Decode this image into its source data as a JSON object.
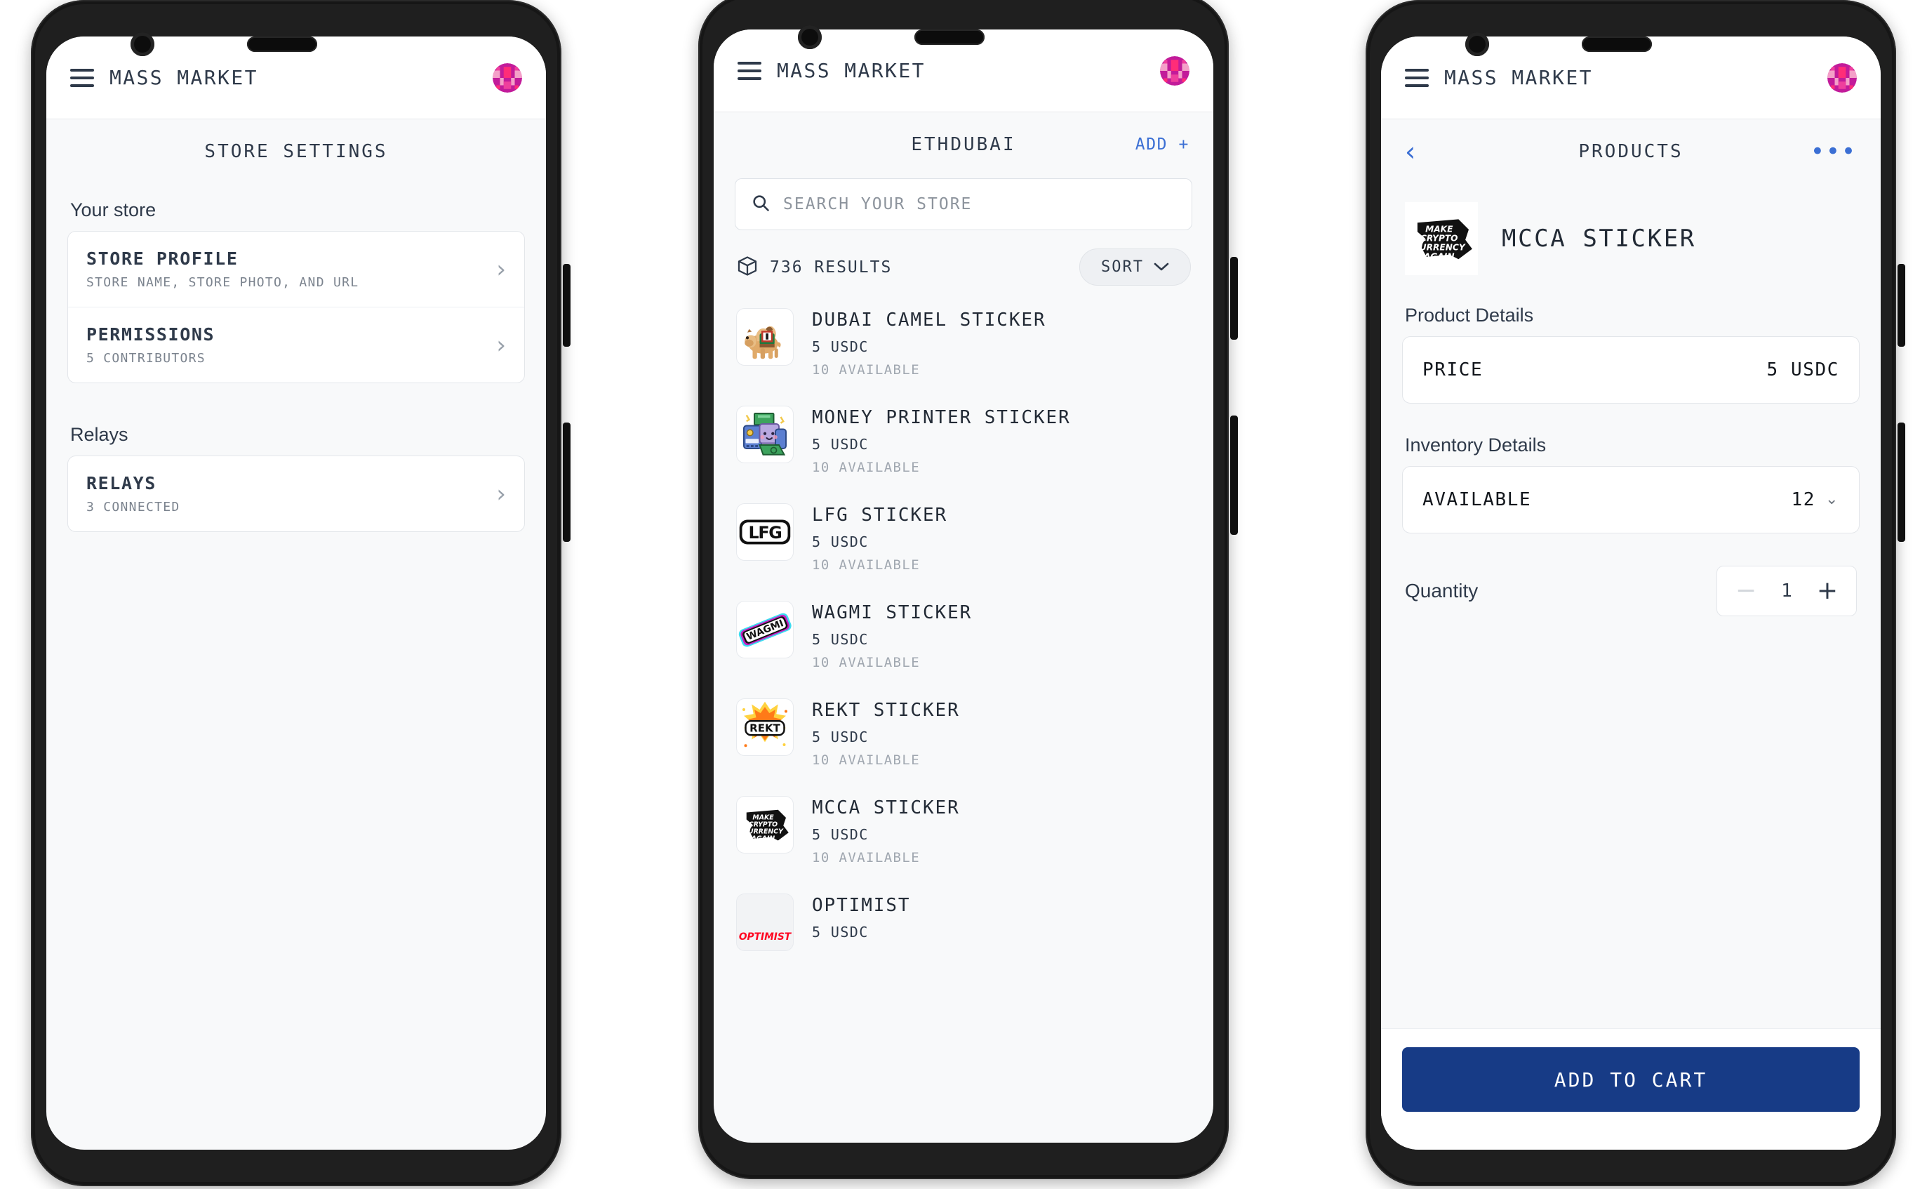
{
  "app": {
    "brand": "MASS MARKET",
    "menu_icon": "hamburger-icon",
    "avatar_icon": "blockie-avatar"
  },
  "colors": {
    "accent_blue": "#3b6fd4",
    "cta_blue": "#173b86",
    "avatar_magenta": "#c21b9a",
    "avatar_pink": "#ef3f9d",
    "text_dark": "#2f3a4a",
    "text_muted": "#a0a7b0",
    "screen_bg": "#f8f9fa"
  },
  "screen1": {
    "page_title": "STORE SETTINGS",
    "sections": [
      {
        "label": "Your store",
        "rows": [
          {
            "title": "STORE PROFILE",
            "subtitle": "STORE NAME, STORE PHOTO, AND URL",
            "chevron": "chevron-right-icon"
          },
          {
            "title": "PERMISSIONS",
            "subtitle": "5 CONTRIBUTORS",
            "chevron": "chevron-right-icon"
          }
        ]
      },
      {
        "label": "Relays",
        "rows": [
          {
            "title": "RELAYS",
            "subtitle": "3 CONNECTED",
            "chevron": "chevron-right-icon"
          }
        ]
      }
    ]
  },
  "screen2": {
    "page_title": "ETHDUBAI",
    "add_label": "ADD +",
    "search": {
      "placeholder": "SEARCH YOUR STORE",
      "value": "",
      "icon": "search-icon"
    },
    "results": {
      "icon": "box-icon",
      "count_label": "736 RESULTS",
      "sort_label": "SORT",
      "sort_icon": "chevron-down-icon"
    },
    "products": [
      {
        "name": "DUBAI CAMEL STICKER",
        "price": "5 USDC",
        "available": "10 AVAILABLE",
        "image": "camel-sticker"
      },
      {
        "name": "MONEY PRINTER STICKER",
        "price": "5 USDC",
        "available": "10 AVAILABLE",
        "image": "printer-sticker"
      },
      {
        "name": "LFG STICKER",
        "price": "5 USDC",
        "available": "10 AVAILABLE",
        "image": "lfg-sticker"
      },
      {
        "name": "WAGMI STICKER",
        "price": "5 USDC",
        "available": "10 AVAILABLE",
        "image": "wagmi-sticker"
      },
      {
        "name": "REKT STICKER",
        "price": "5 USDC",
        "available": "10 AVAILABLE",
        "image": "rekt-sticker"
      },
      {
        "name": "MCCA STICKER",
        "price": "5 USDC",
        "available": "10 AVAILABLE",
        "image": "mcca-sticker"
      },
      {
        "name": "OPTIMIST",
        "price": "5 USDC",
        "available": "",
        "image": "optimist-sticker"
      }
    ]
  },
  "screen3": {
    "page_title": "PRODUCTS",
    "back_icon": "chevron-left-icon",
    "more_icon": "ellipsis-icon",
    "product": {
      "name": "MCCA STICKER",
      "image": "mcca-sticker"
    },
    "product_details": {
      "label": "Product Details",
      "rows": [
        {
          "label": "PRICE",
          "value": "5 USDC"
        }
      ]
    },
    "inventory_details": {
      "label": "Inventory Details",
      "rows": [
        {
          "label": "AVAILABLE",
          "value": "12",
          "chevron": "chevron-down-icon"
        }
      ]
    },
    "quantity": {
      "label": "Quantity",
      "value": "1",
      "minus": "−",
      "plus": "+"
    },
    "cta_label": "ADD TO CART"
  }
}
